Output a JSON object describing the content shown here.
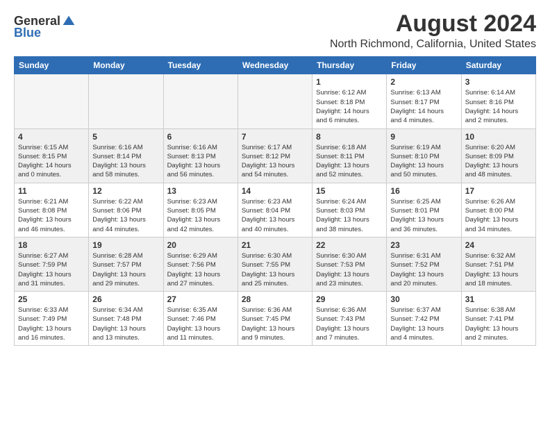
{
  "logo": {
    "general": "General",
    "blue": "Blue"
  },
  "title": "August 2024",
  "subtitle": "North Richmond, California, United States",
  "days_header": [
    "Sunday",
    "Monday",
    "Tuesday",
    "Wednesday",
    "Thursday",
    "Friday",
    "Saturday"
  ],
  "weeks": [
    [
      {
        "day": "",
        "info": ""
      },
      {
        "day": "",
        "info": ""
      },
      {
        "day": "",
        "info": ""
      },
      {
        "day": "",
        "info": ""
      },
      {
        "day": "1",
        "info": "Sunrise: 6:12 AM\nSunset: 8:18 PM\nDaylight: 14 hours\nand 6 minutes."
      },
      {
        "day": "2",
        "info": "Sunrise: 6:13 AM\nSunset: 8:17 PM\nDaylight: 14 hours\nand 4 minutes."
      },
      {
        "day": "3",
        "info": "Sunrise: 6:14 AM\nSunset: 8:16 PM\nDaylight: 14 hours\nand 2 minutes."
      }
    ],
    [
      {
        "day": "4",
        "info": "Sunrise: 6:15 AM\nSunset: 8:15 PM\nDaylight: 14 hours\nand 0 minutes."
      },
      {
        "day": "5",
        "info": "Sunrise: 6:16 AM\nSunset: 8:14 PM\nDaylight: 13 hours\nand 58 minutes."
      },
      {
        "day": "6",
        "info": "Sunrise: 6:16 AM\nSunset: 8:13 PM\nDaylight: 13 hours\nand 56 minutes."
      },
      {
        "day": "7",
        "info": "Sunrise: 6:17 AM\nSunset: 8:12 PM\nDaylight: 13 hours\nand 54 minutes."
      },
      {
        "day": "8",
        "info": "Sunrise: 6:18 AM\nSunset: 8:11 PM\nDaylight: 13 hours\nand 52 minutes."
      },
      {
        "day": "9",
        "info": "Sunrise: 6:19 AM\nSunset: 8:10 PM\nDaylight: 13 hours\nand 50 minutes."
      },
      {
        "day": "10",
        "info": "Sunrise: 6:20 AM\nSunset: 8:09 PM\nDaylight: 13 hours\nand 48 minutes."
      }
    ],
    [
      {
        "day": "11",
        "info": "Sunrise: 6:21 AM\nSunset: 8:08 PM\nDaylight: 13 hours\nand 46 minutes."
      },
      {
        "day": "12",
        "info": "Sunrise: 6:22 AM\nSunset: 8:06 PM\nDaylight: 13 hours\nand 44 minutes."
      },
      {
        "day": "13",
        "info": "Sunrise: 6:23 AM\nSunset: 8:05 PM\nDaylight: 13 hours\nand 42 minutes."
      },
      {
        "day": "14",
        "info": "Sunrise: 6:23 AM\nSunset: 8:04 PM\nDaylight: 13 hours\nand 40 minutes."
      },
      {
        "day": "15",
        "info": "Sunrise: 6:24 AM\nSunset: 8:03 PM\nDaylight: 13 hours\nand 38 minutes."
      },
      {
        "day": "16",
        "info": "Sunrise: 6:25 AM\nSunset: 8:01 PM\nDaylight: 13 hours\nand 36 minutes."
      },
      {
        "day": "17",
        "info": "Sunrise: 6:26 AM\nSunset: 8:00 PM\nDaylight: 13 hours\nand 34 minutes."
      }
    ],
    [
      {
        "day": "18",
        "info": "Sunrise: 6:27 AM\nSunset: 7:59 PM\nDaylight: 13 hours\nand 31 minutes."
      },
      {
        "day": "19",
        "info": "Sunrise: 6:28 AM\nSunset: 7:57 PM\nDaylight: 13 hours\nand 29 minutes."
      },
      {
        "day": "20",
        "info": "Sunrise: 6:29 AM\nSunset: 7:56 PM\nDaylight: 13 hours\nand 27 minutes."
      },
      {
        "day": "21",
        "info": "Sunrise: 6:30 AM\nSunset: 7:55 PM\nDaylight: 13 hours\nand 25 minutes."
      },
      {
        "day": "22",
        "info": "Sunrise: 6:30 AM\nSunset: 7:53 PM\nDaylight: 13 hours\nand 23 minutes."
      },
      {
        "day": "23",
        "info": "Sunrise: 6:31 AM\nSunset: 7:52 PM\nDaylight: 13 hours\nand 20 minutes."
      },
      {
        "day": "24",
        "info": "Sunrise: 6:32 AM\nSunset: 7:51 PM\nDaylight: 13 hours\nand 18 minutes."
      }
    ],
    [
      {
        "day": "25",
        "info": "Sunrise: 6:33 AM\nSunset: 7:49 PM\nDaylight: 13 hours\nand 16 minutes."
      },
      {
        "day": "26",
        "info": "Sunrise: 6:34 AM\nSunset: 7:48 PM\nDaylight: 13 hours\nand 13 minutes."
      },
      {
        "day": "27",
        "info": "Sunrise: 6:35 AM\nSunset: 7:46 PM\nDaylight: 13 hours\nand 11 minutes."
      },
      {
        "day": "28",
        "info": "Sunrise: 6:36 AM\nSunset: 7:45 PM\nDaylight: 13 hours\nand 9 minutes."
      },
      {
        "day": "29",
        "info": "Sunrise: 6:36 AM\nSunset: 7:43 PM\nDaylight: 13 hours\nand 7 minutes."
      },
      {
        "day": "30",
        "info": "Sunrise: 6:37 AM\nSunset: 7:42 PM\nDaylight: 13 hours\nand 4 minutes."
      },
      {
        "day": "31",
        "info": "Sunrise: 6:38 AM\nSunset: 7:41 PM\nDaylight: 13 hours\nand 2 minutes."
      }
    ]
  ]
}
